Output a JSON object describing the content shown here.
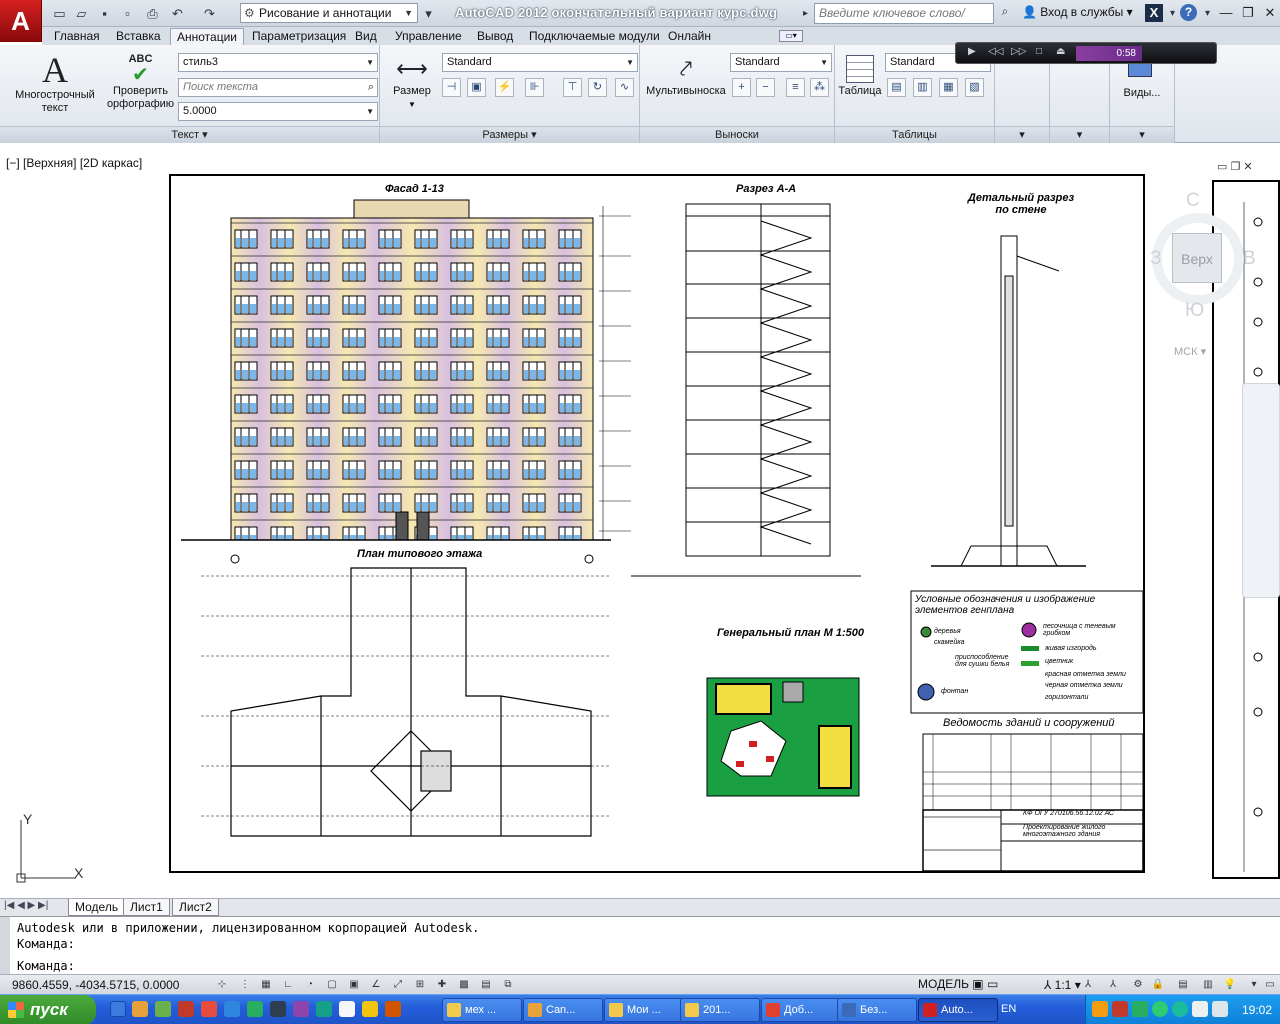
{
  "title_bar": {
    "workspace": "Рисование и аннотации",
    "app_title": "AutoCAD 2012    окончательный вариант курс.dwg",
    "search_placeholder": "Введите ключевое слово/фразу",
    "login": "Вход в службы",
    "logo": "A"
  },
  "tabs": [
    {
      "label": "Главная"
    },
    {
      "label": "Вставка"
    },
    {
      "label": "Аннотации"
    },
    {
      "label": "Параметризация"
    },
    {
      "label": "Вид"
    },
    {
      "label": "Управление"
    },
    {
      "label": "Вывод"
    },
    {
      "label": "Подключаемые модули"
    },
    {
      "label": "Онлайн"
    }
  ],
  "ribbon": {
    "text_panel": {
      "label": "Текст",
      "mtext": "Многострочный текст",
      "spell": "Проверить орфографию",
      "spell_icon_text": "ABC",
      "style": "стиль3",
      "find_placeholder": "Поиск текста",
      "height": "5.0000"
    },
    "dims_panel": {
      "label": "Размеры",
      "dim_button": "Размер",
      "style": "Standard"
    },
    "leaders_panel": {
      "label": "Выноски",
      "mleader": "Мультивыноска",
      "style": "Standard"
    },
    "tables_panel": {
      "label": "Таблицы",
      "table": "Таблица",
      "style": "Standard"
    },
    "views_panel": {
      "label": "Виды..."
    }
  },
  "media": {
    "time": "0:58"
  },
  "viewport": {
    "label": "[−] [Верхняя] [2D каркас]"
  },
  "viewcube": {
    "north": "С",
    "east": "В",
    "west": "З",
    "south": "Ю",
    "face": "Верх",
    "wcs": "МСК"
  },
  "drawing": {
    "facade_title": "Фасад  1-13",
    "section_title": "Разрез А-А",
    "detail_title": "Детальный разрез по стене",
    "plan_title": "План типового этажа",
    "genplan_title": "Генеральный план М 1:500",
    "legend_title": "Условные обозначения и изображение элементов генплана",
    "legend_items": [
      {
        "label": "деревья",
        "color": "#3a8a3a"
      },
      {
        "label": "скамейка",
        "color": "#555555"
      },
      {
        "label": "приспособление для сушки белья",
        "color": "#333333"
      },
      {
        "label": "песочница с теневым грибком",
        "color": "#9b2fa0"
      },
      {
        "label": "живая изгородь",
        "color": "#1a8a2a"
      },
      {
        "label": "цветник",
        "color": "#2fa02f"
      },
      {
        "label": "красная отметка земли",
        "color": "#d02020"
      },
      {
        "label": "черная отметка земли",
        "color": "#000000"
      },
      {
        "label": "фонтан",
        "color": "#4060b0"
      },
      {
        "label": "горизонтали",
        "color": "#000000"
      }
    ],
    "buildings_title": "Ведомость зданий и сооружений",
    "stamp_code": "КФ ОГУ 270106.56.12.02  АС",
    "stamp_title": "Проектирование жилого многоэтажного здания",
    "axis_y": "Y",
    "axis_x": "X"
  },
  "layout_tabs": [
    {
      "label": "Модель"
    },
    {
      "label": "Лист1"
    },
    {
      "label": "Лист2"
    }
  ],
  "command": {
    "line1": "Autodesk или в приложении, лицензированном корпорацией Autodesk.",
    "line2": "Команда:",
    "line3": "Команда:"
  },
  "status": {
    "coords": "9860.4559, -4034.5715, 0.0000",
    "model": "МОДЕЛЬ",
    "scale": "1:1"
  },
  "taskbar": {
    "start": "пуск",
    "buttons": [
      {
        "label": "мех ...",
        "color": "#f2c94c"
      },
      {
        "label": "Can...",
        "color": "#e8a23a"
      },
      {
        "label": "Мои ...",
        "color": "#f2c94c"
      },
      {
        "label": "201...",
        "color": "#f2c94c"
      },
      {
        "label": "Доб...",
        "color": "#e04030"
      },
      {
        "label": "Без...",
        "color": "#3a6ab8"
      },
      {
        "label": "Auto...",
        "color": "#d02020"
      }
    ],
    "lang": "EN",
    "clock": "19:02"
  }
}
